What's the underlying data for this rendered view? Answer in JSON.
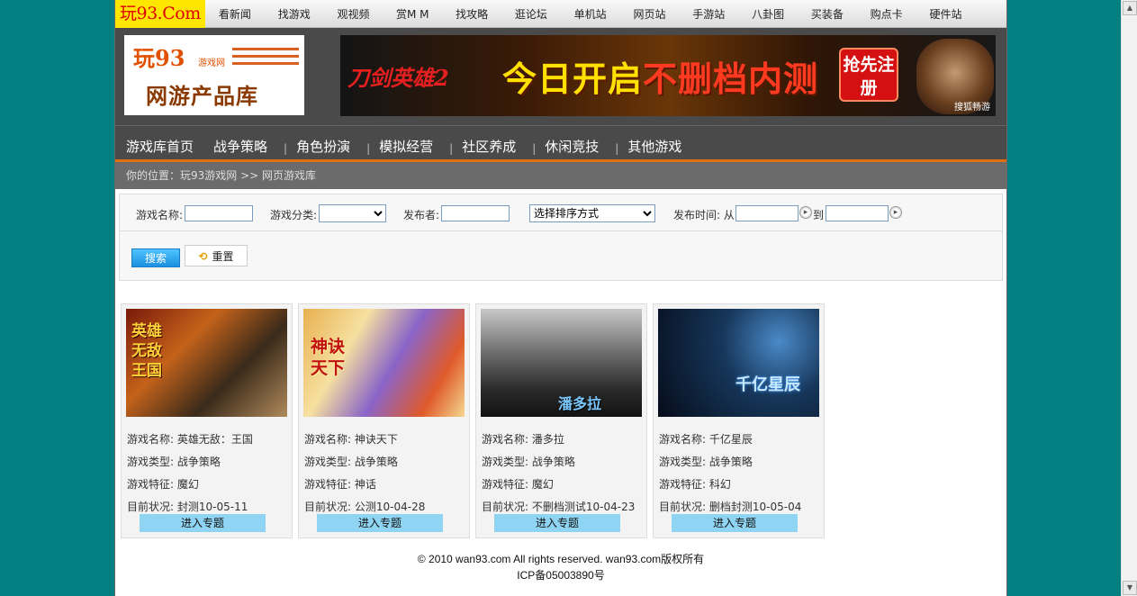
{
  "site_logo": "玩93.Com",
  "top_nav": [
    "看新闻",
    "找游戏",
    "观视频",
    "赏M M",
    "找攻略",
    "逛论坛",
    "单机站",
    "网页站",
    "手游站",
    "八卦图",
    "买装备",
    "购点卡",
    "硬件站"
  ],
  "header": {
    "logo_line1": "玩93",
    "logo_small": "游戏网",
    "logo_line2": "网游产品库",
    "banner_brand_a": "刀剑",
    "banner_brand_b": "英雄2",
    "banner_text_a": "今日开启",
    "banner_text_b": "不删档内测",
    "banner_button": "抢先注册",
    "banner_small": "搜狐畅游"
  },
  "category_nav": [
    "游戏库首页",
    "战争策略",
    "角色扮演",
    "模拟经营",
    "社区养成",
    "休闲竞技",
    "其他游戏"
  ],
  "breadcrumb": "你的位置：玩93游戏网  >> 网页游戏库",
  "search": {
    "name_label": "游戏名称:",
    "category_label": "游戏分类:",
    "publisher_label": "发布者:",
    "sort_value": "选择排序方式",
    "time_label": "发布时间: 从",
    "to_label": "到",
    "search_button": "搜索",
    "reset_button": "重置"
  },
  "card_labels": {
    "name": "游戏名称:",
    "type": "游戏类型:",
    "feature": "游戏特征:",
    "status": "目前状况:",
    "enter": "进入专题"
  },
  "games": [
    {
      "name": "英雄无敌：王国",
      "type": "战争策略",
      "feature": "魔幻",
      "status": "封测10-05-11",
      "thumb_text": "英雄无敌 王国"
    },
    {
      "name": "神诀天下",
      "type": "战争策略",
      "feature": "神话",
      "status": "公测10-04-28",
      "thumb_text": "神诀天下"
    },
    {
      "name": "潘多拉",
      "type": "战争策略",
      "feature": "魔幻",
      "status": "不删档测试10-04-23",
      "thumb_text": "潘多拉"
    },
    {
      "name": "千亿星辰",
      "type": "战争策略",
      "feature": "科幻",
      "status": "删档封测10-05-04",
      "thumb_text": "千亿星辰"
    }
  ],
  "footer": {
    "line1": "© 2010 wan93.com All rights reserved. wan93.com版权所有",
    "line2": "ICP备05003890号"
  },
  "colors": {
    "background": "#008080",
    "accent": "#e07010",
    "dark": "#4a4a4a",
    "enter_button": "#8fd4f2"
  }
}
